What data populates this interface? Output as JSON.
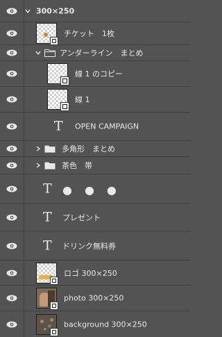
{
  "layers": {
    "artboard": {
      "name": "300×250",
      "expanded": true
    },
    "ticket": {
      "name": "チケット　1枚",
      "thumb": "ticket-thumbnail"
    },
    "underline_group": {
      "name": "アンダーライン　まとめ",
      "expanded": true
    },
    "line_copy": {
      "name": "線 1 のコピー"
    },
    "line1": {
      "name": "線 1"
    },
    "open_campaign": {
      "name": "OPEN CAMPAIGN"
    },
    "polygon_group": {
      "name": "多角形　まとめ",
      "expanded": false
    },
    "brown_band_group": {
      "name": "茶色　帯",
      "expanded": false
    },
    "dots_text": {
      "name": "●　●　●"
    },
    "present_text": {
      "name": "プレゼント"
    },
    "drink_text": {
      "name": "ドリンク無料券"
    },
    "logo": {
      "name": "ロゴ 300×250"
    },
    "photo": {
      "name": "photo 300×250"
    },
    "background": {
      "name": "background 300×250"
    }
  },
  "colors": {
    "panel_bg": "#535353",
    "divider": "#3f3f3f",
    "text": "#e8e8e8"
  },
  "icons": [
    "eye-icon",
    "chevron-down-icon",
    "chevron-right-icon",
    "folder-icon",
    "type-layer-icon",
    "smart-object-badge-icon",
    "shape-layer-badge-icon"
  ]
}
